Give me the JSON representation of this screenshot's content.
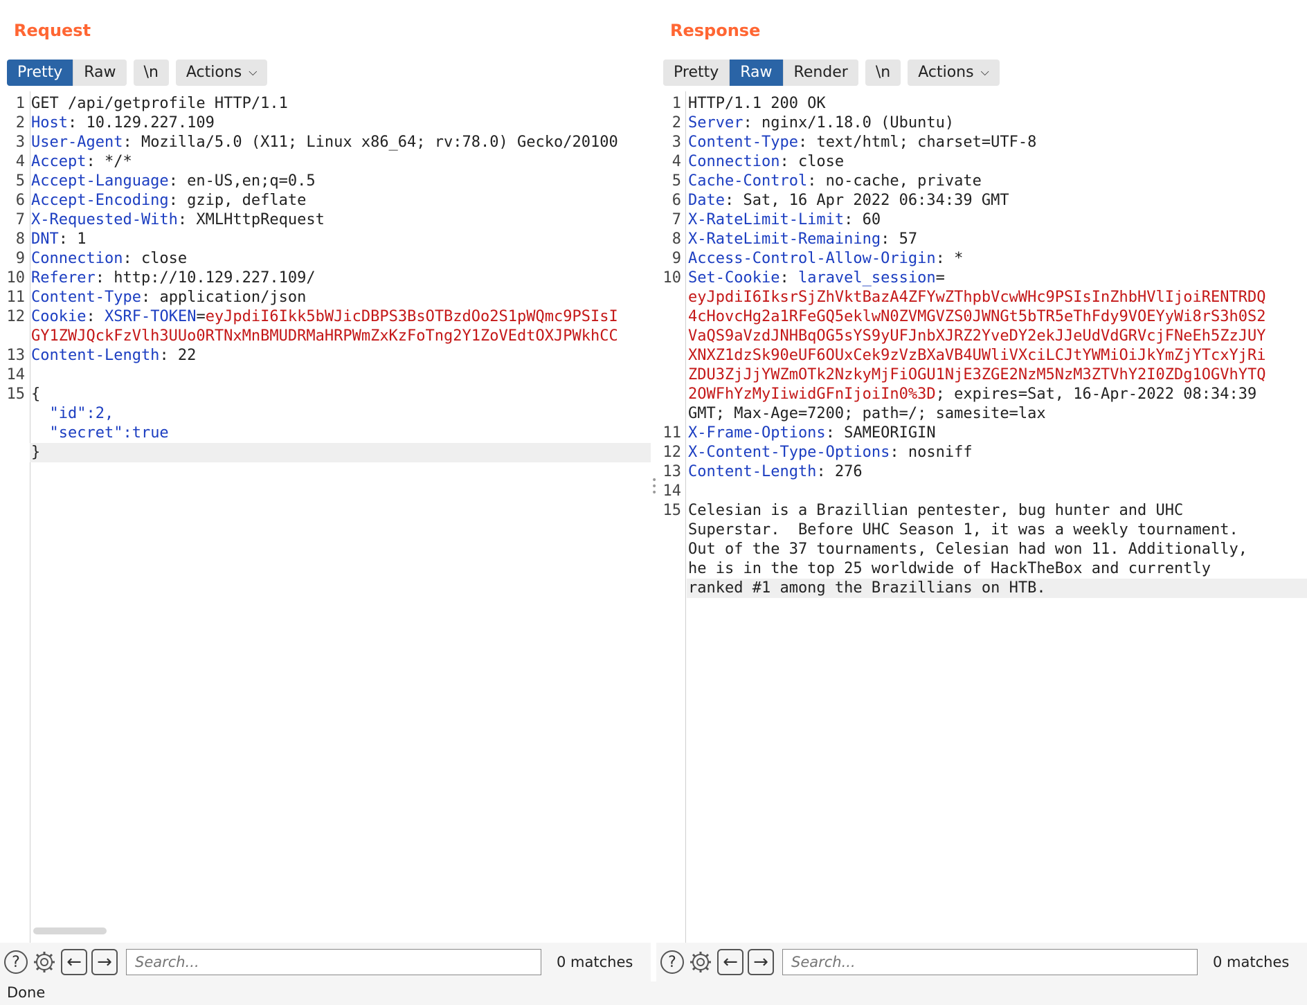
{
  "request": {
    "title": "Request",
    "tabs": [
      {
        "label": "Pretty",
        "active": true
      },
      {
        "label": "Raw",
        "active": false
      }
    ],
    "newline_label": "\\n",
    "actions_label": "Actions",
    "lines": [
      {
        "n": "1",
        "parts": [
          {
            "t": "GET /api/getprofile HTTP/1.1",
            "c": "v"
          }
        ]
      },
      {
        "n": "2",
        "parts": [
          {
            "t": "Host",
            "c": "k"
          },
          {
            "t": ": 10.129.227.109",
            "c": "v"
          }
        ]
      },
      {
        "n": "3",
        "parts": [
          {
            "t": "User-Agent",
            "c": "k"
          },
          {
            "t": ": Mozilla/5.0 (X11; Linux x86_64; rv:78.0) Gecko/20100",
            "c": "v"
          }
        ]
      },
      {
        "n": "4",
        "parts": [
          {
            "t": "Accept",
            "c": "k"
          },
          {
            "t": ": */*",
            "c": "v"
          }
        ]
      },
      {
        "n": "5",
        "parts": [
          {
            "t": "Accept-Language",
            "c": "k"
          },
          {
            "t": ": en-US,en;q=0.5",
            "c": "v"
          }
        ]
      },
      {
        "n": "6",
        "parts": [
          {
            "t": "Accept-Encoding",
            "c": "k"
          },
          {
            "t": ": gzip, deflate",
            "c": "v"
          }
        ]
      },
      {
        "n": "7",
        "parts": [
          {
            "t": "X-Requested-With",
            "c": "k"
          },
          {
            "t": ": XMLHttpRequest",
            "c": "v"
          }
        ]
      },
      {
        "n": "8",
        "parts": [
          {
            "t": "DNT",
            "c": "k"
          },
          {
            "t": ": 1",
            "c": "v"
          }
        ]
      },
      {
        "n": "9",
        "parts": [
          {
            "t": "Connection",
            "c": "k"
          },
          {
            "t": ": close",
            "c": "v"
          }
        ]
      },
      {
        "n": "10",
        "parts": [
          {
            "t": "Referer",
            "c": "k"
          },
          {
            "t": ": http://10.129.227.109/",
            "c": "v"
          }
        ]
      },
      {
        "n": "11",
        "parts": [
          {
            "t": "Content-Type",
            "c": "k"
          },
          {
            "t": ": application/json",
            "c": "v"
          }
        ]
      },
      {
        "n": "12",
        "parts": [
          {
            "t": "Cookie",
            "c": "k"
          },
          {
            "t": ": ",
            "c": "v"
          },
          {
            "t": "XSRF-TOKEN",
            "c": "k"
          },
          {
            "t": "=",
            "c": "v"
          },
          {
            "t": "eyJpdiI6Ikk5bWJicDBPS3BsOTBzdOo2S1pWQmc9PSIsI",
            "c": "r"
          }
        ]
      },
      {
        "n": "",
        "parts": [
          {
            "t": "GY1ZWJQckFzVlh3UUo0RTNxMnBMUDRMaHRPWmZxKzFoTng2Y1ZoVEdtOXJPWkhCC",
            "c": "r"
          }
        ]
      },
      {
        "n": "13",
        "parts": [
          {
            "t": "Content-Length",
            "c": "k"
          },
          {
            "t": ": 22",
            "c": "v"
          }
        ]
      },
      {
        "n": "14",
        "parts": []
      },
      {
        "n": "15",
        "parts": [
          {
            "t": "{",
            "c": "v"
          }
        ]
      },
      {
        "n": "",
        "parts": [
          {
            "t": "  \"id\"",
            "c": "k"
          },
          {
            "t": ":2,",
            "c": "k"
          }
        ]
      },
      {
        "n": "",
        "parts": [
          {
            "t": "  \"secret\"",
            "c": "k"
          },
          {
            "t": ":true",
            "c": "k"
          }
        ]
      },
      {
        "n": "",
        "parts": [
          {
            "t": "}",
            "c": "v"
          }
        ],
        "current": true
      }
    ],
    "search_placeholder": "Search...",
    "matches": "0 matches"
  },
  "response": {
    "title": "Response",
    "tabs": [
      {
        "label": "Pretty",
        "active": false
      },
      {
        "label": "Raw",
        "active": true
      },
      {
        "label": "Render",
        "active": false
      }
    ],
    "newline_label": "\\n",
    "actions_label": "Actions",
    "lines": [
      {
        "n": "1",
        "parts": [
          {
            "t": "HTTP/1.1 200 OK",
            "c": "v"
          }
        ]
      },
      {
        "n": "2",
        "parts": [
          {
            "t": "Server",
            "c": "k"
          },
          {
            "t": ": nginx/1.18.0 (Ubuntu)",
            "c": "v"
          }
        ]
      },
      {
        "n": "3",
        "parts": [
          {
            "t": "Content-Type",
            "c": "k"
          },
          {
            "t": ": text/html; charset=UTF-8",
            "c": "v"
          }
        ]
      },
      {
        "n": "4",
        "parts": [
          {
            "t": "Connection",
            "c": "k"
          },
          {
            "t": ": close",
            "c": "v"
          }
        ]
      },
      {
        "n": "5",
        "parts": [
          {
            "t": "Cache-Control",
            "c": "k"
          },
          {
            "t": ": no-cache, private",
            "c": "v"
          }
        ]
      },
      {
        "n": "6",
        "parts": [
          {
            "t": "Date",
            "c": "k"
          },
          {
            "t": ": Sat, 16 Apr 2022 06:34:39 GMT",
            "c": "v"
          }
        ]
      },
      {
        "n": "7",
        "parts": [
          {
            "t": "X-RateLimit-Limit",
            "c": "k"
          },
          {
            "t": ": 60",
            "c": "v"
          }
        ]
      },
      {
        "n": "8",
        "parts": [
          {
            "t": "X-RateLimit-Remaining",
            "c": "k"
          },
          {
            "t": ": 57",
            "c": "v"
          }
        ]
      },
      {
        "n": "9",
        "parts": [
          {
            "t": "Access-Control-Allow-Origin",
            "c": "k"
          },
          {
            "t": ": *",
            "c": "v"
          }
        ]
      },
      {
        "n": "10",
        "parts": [
          {
            "t": "Set-Cookie",
            "c": "k"
          },
          {
            "t": ": ",
            "c": "v"
          },
          {
            "t": "laravel_session",
            "c": "k"
          },
          {
            "t": "=",
            "c": "v"
          }
        ]
      },
      {
        "n": "",
        "parts": [
          {
            "t": "eyJpdiI6IksrSjZhVktBazA4ZFYwZThpbVcwWHc9PSIsInZhbHVlIjoiRENTRDQ",
            "c": "r"
          }
        ]
      },
      {
        "n": "",
        "parts": [
          {
            "t": "4cHovcHg2a1RFeGQ5eklwN0ZVMGVZS0JWNGt5bTR5eThFdy9VOEYyWi8rS3h0S2",
            "c": "r"
          }
        ]
      },
      {
        "n": "",
        "parts": [
          {
            "t": "VaQS9aVzdJNHBqOG5sYS9yUFJnbXJRZ2YveDY2ekJJeUdVdGRVcjFNeEh5ZzJUY",
            "c": "r"
          }
        ]
      },
      {
        "n": "",
        "parts": [
          {
            "t": "XNXZ1dzSk90eUF6OUxCek9zVzBXaVB4UWliVXciLCJtYWMiOiJkYmZjYTcxYjRi",
            "c": "r"
          }
        ]
      },
      {
        "n": "",
        "parts": [
          {
            "t": "ZDU3ZjJjYWZmOTk2NzkyMjFiOGU1NjE3ZGE2NzM5NzM3ZTVhY2I0ZDg1OGVhYTQ",
            "c": "r"
          }
        ]
      },
      {
        "n": "",
        "parts": [
          {
            "t": "2OWFhYzMyIiwidGFnIjoiIn0%3D",
            "c": "r"
          },
          {
            "t": "; expires=Sat, 16-Apr-2022 08:34:39",
            "c": "v"
          }
        ]
      },
      {
        "n": "",
        "parts": [
          {
            "t": "GMT; Max-Age=7200; path=/; samesite=lax",
            "c": "v"
          }
        ]
      },
      {
        "n": "11",
        "parts": [
          {
            "t": "X-Frame-Options",
            "c": "k"
          },
          {
            "t": ": SAMEORIGIN",
            "c": "v"
          }
        ]
      },
      {
        "n": "12",
        "parts": [
          {
            "t": "X-Content-Type-Options",
            "c": "k"
          },
          {
            "t": ": nosniff",
            "c": "v"
          }
        ]
      },
      {
        "n": "13",
        "parts": [
          {
            "t": "Content-Length",
            "c": "k"
          },
          {
            "t": ": 276",
            "c": "v"
          }
        ]
      },
      {
        "n": "14",
        "parts": []
      },
      {
        "n": "15",
        "parts": [
          {
            "t": "Celesian is a Brazillian pentester, bug hunter and UHC",
            "c": "v"
          }
        ]
      },
      {
        "n": "",
        "parts": [
          {
            "t": "Superstar.  Before UHC Season 1, it was a weekly tournament.",
            "c": "v"
          }
        ]
      },
      {
        "n": "",
        "parts": [
          {
            "t": "Out of the 37 tournaments, Celesian had won 11. Additionally,",
            "c": "v"
          }
        ]
      },
      {
        "n": "",
        "parts": [
          {
            "t": "he is in the top 25 worldwide of HackTheBox and currently",
            "c": "v"
          }
        ]
      },
      {
        "n": "",
        "parts": [
          {
            "t": "ranked #1 among the Brazillians on HTB.",
            "c": "v"
          }
        ],
        "current": true
      }
    ],
    "search_placeholder": "Search...",
    "matches": "0 matches"
  },
  "status": "Done",
  "icons": {
    "help": "help-icon",
    "settings": "gear-icon",
    "back": "arrow-left-icon",
    "forward": "arrow-right-icon",
    "chevron": "chevron-down-icon",
    "layout_split": "layout-side-by-side-icon",
    "layout_stacked": "layout-stacked-icon",
    "layout_single": "layout-single-icon"
  },
  "colors": {
    "accent": "#2a64a6",
    "title": "#ff6633",
    "header_key": "#1c3ec1",
    "cookie_value": "#c41818"
  }
}
